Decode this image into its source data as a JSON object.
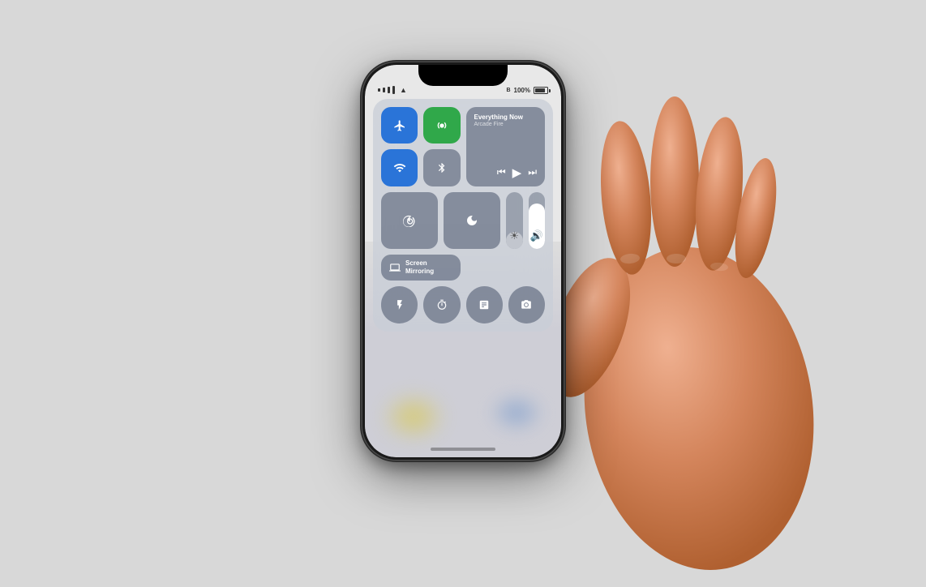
{
  "page": {
    "bg_color": "#d4d4d4"
  },
  "status_bar": {
    "battery_percent": "100%",
    "bluetooth_label": "B"
  },
  "music": {
    "title": "Everything Now",
    "artist": "Arcade Fire"
  },
  "control_center": {
    "buttons": {
      "airplane": "✈",
      "cellular": "📶",
      "wifi": "wifi",
      "bluetooth": "bluetooth",
      "lock": "🔒",
      "moon": "🌙",
      "flashlight": "flashlight",
      "timer": "timer",
      "calculator": "calculator",
      "camera": "camera"
    },
    "screen_mirror_label": "Screen\nMirroring"
  }
}
